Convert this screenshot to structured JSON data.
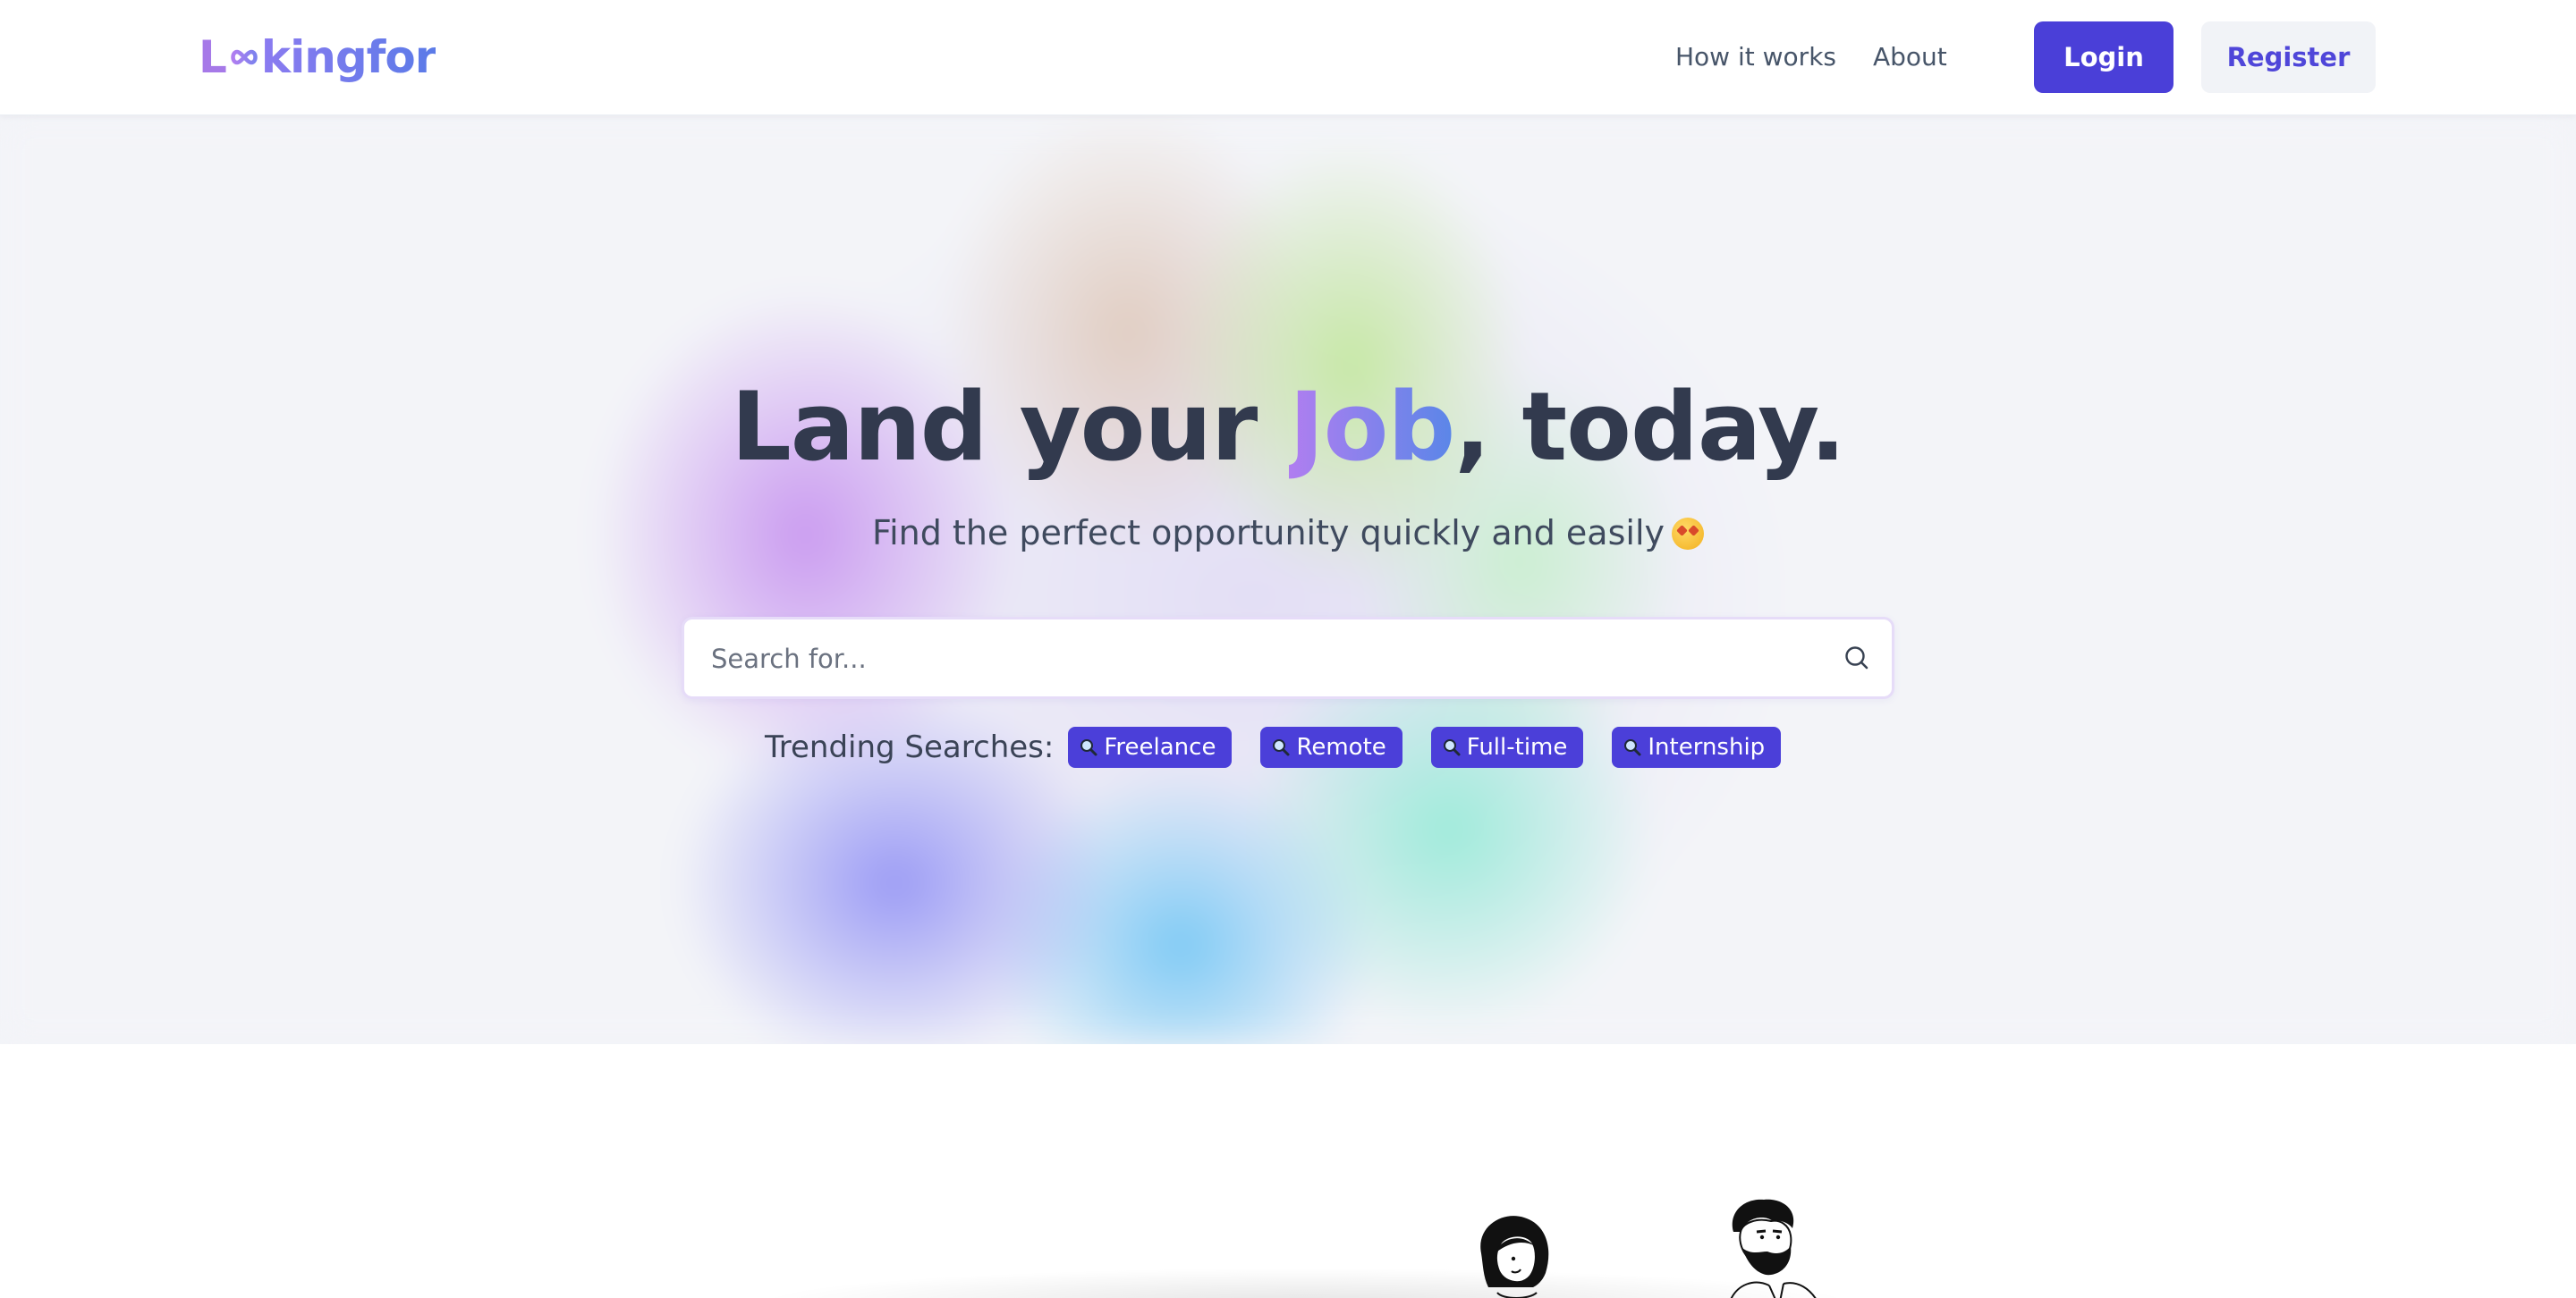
{
  "header": {
    "logo": {
      "part1": "L",
      "part2": "kingfor"
    },
    "nav": [
      {
        "label": "How it works"
      },
      {
        "label": "About"
      }
    ],
    "login_label": "Login",
    "register_label": "Register"
  },
  "hero": {
    "title_prefix": "Land your ",
    "title_highlight": "Job",
    "title_suffix": ", today.",
    "subtitle": "Find the perfect opportunity quickly and easily",
    "search": {
      "placeholder": "Search for...",
      "value": ""
    },
    "trending_label": "Trending Searches:",
    "trending_tags": [
      {
        "label": "Freelance"
      },
      {
        "label": "Remote"
      },
      {
        "label": "Full-time"
      },
      {
        "label": "Internship"
      }
    ]
  },
  "colors": {
    "primary": "#4a3fd8",
    "register_bg": "#f1f3f7",
    "title_text": "#323a4e",
    "highlight_start": "#b07ef0",
    "highlight_end": "#5a86e8"
  },
  "icons": {
    "logo_infinity": "infinity-icon",
    "search": "search-icon",
    "tag": "magnifier-emoji-icon",
    "subtitle_emoji": "star-struck-emoji-icon"
  }
}
